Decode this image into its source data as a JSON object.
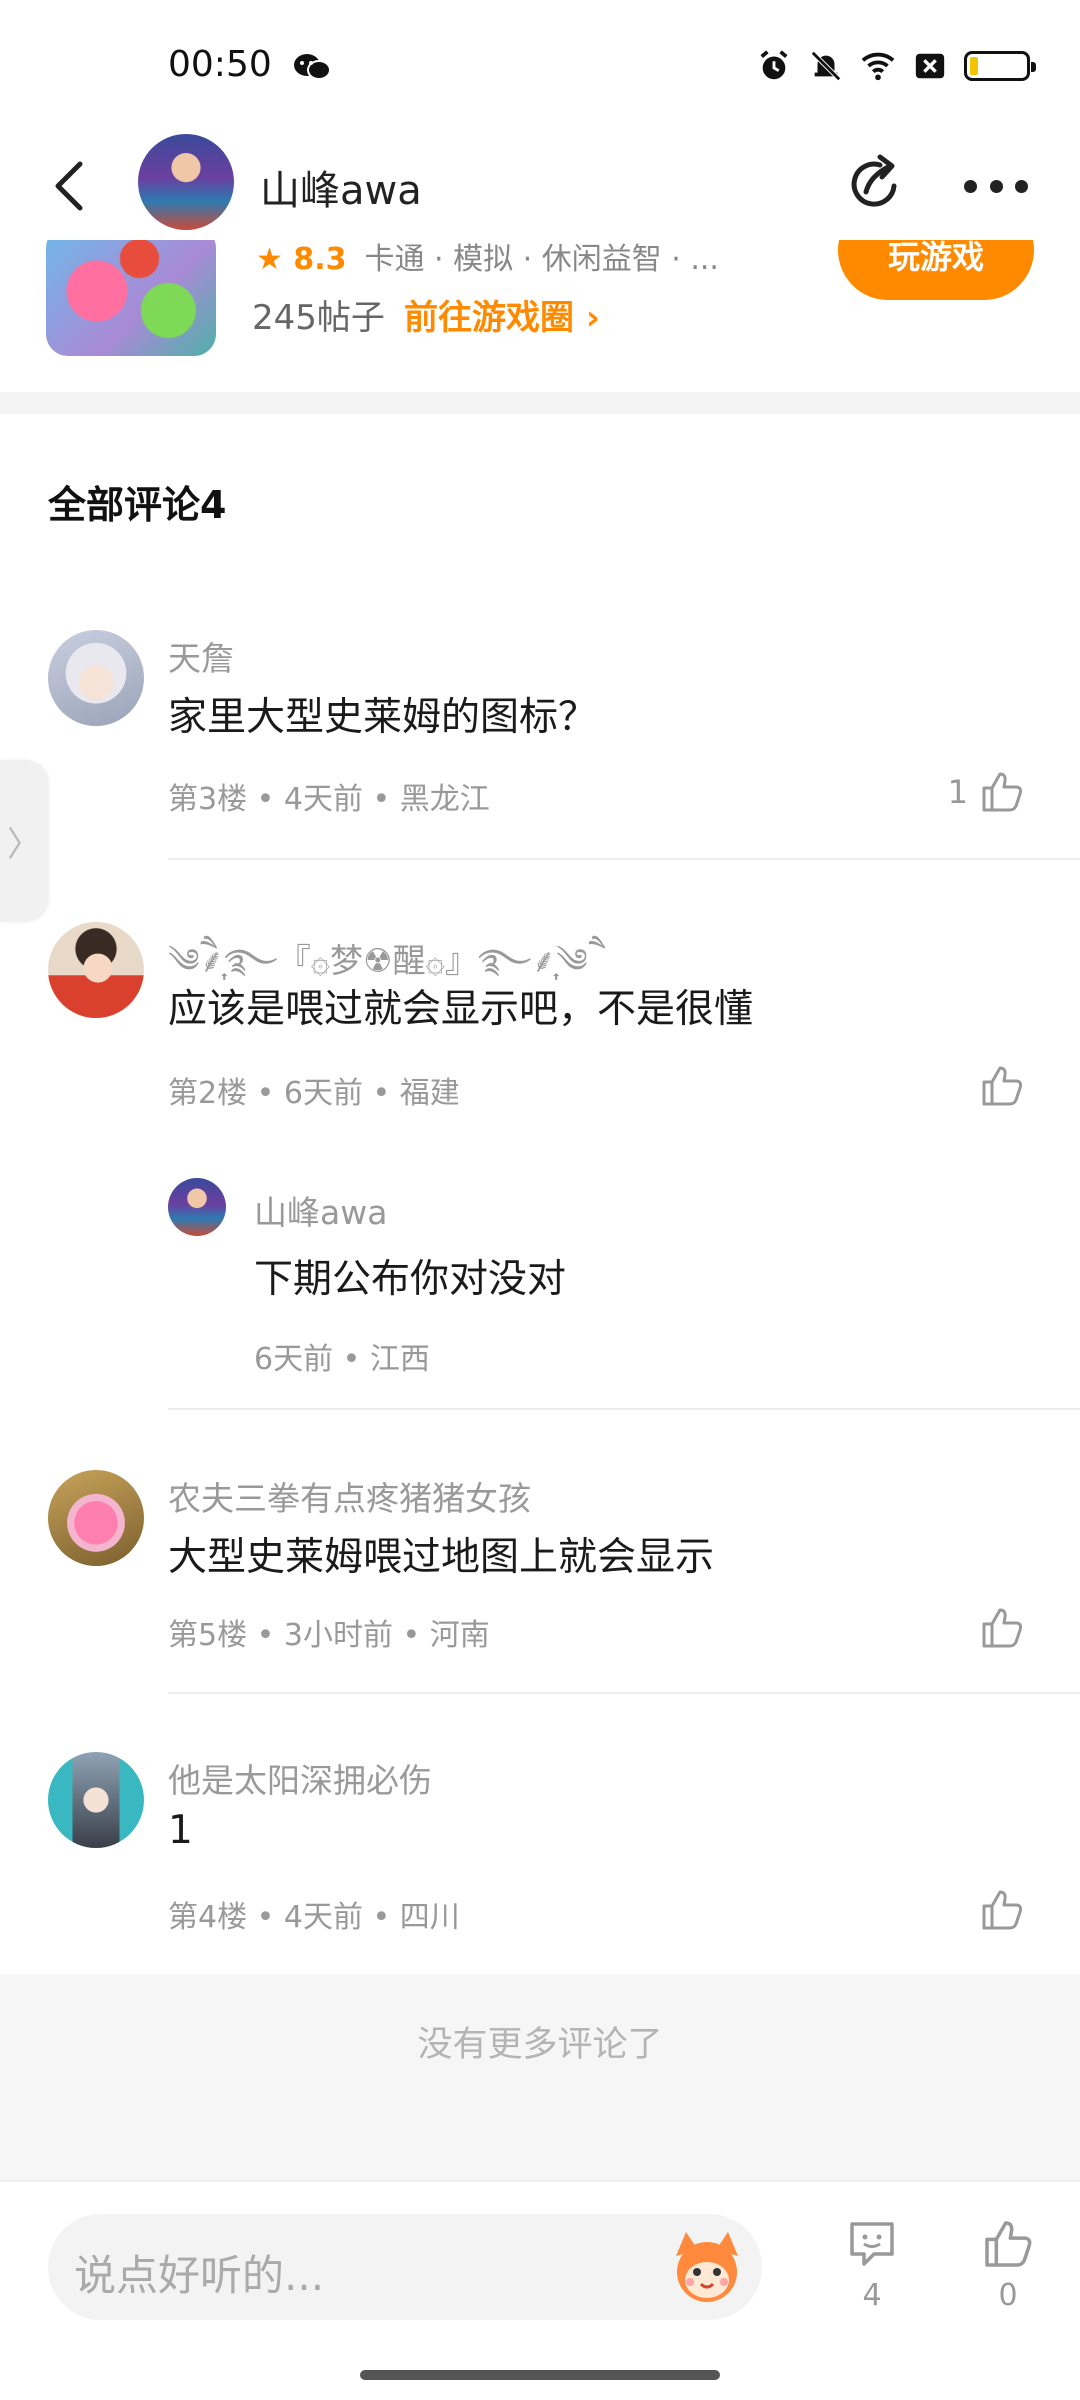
{
  "status": {
    "time": "00:50"
  },
  "header": {
    "name": "山峰awa"
  },
  "game": {
    "rating": "8.3",
    "tags": "卡通 · 模拟 · 休闲益智 · ...",
    "posts": "245帖子",
    "link": "前往游戏圈 ›",
    "play": "玩游戏"
  },
  "comments_title": "全部评论4",
  "comments": [
    {
      "name": "天詹",
      "text": "家里大型史莱姆的图标？",
      "meta": "第3楼 • 4天前 • 黑龙江",
      "likes": "1"
    },
    {
      "name": "༄ཻ⸙͎࿐『۞梦☢醒۞』࿐⸙͎༄ཻ",
      "text": "应该是喂过就会显示吧，不是很懂",
      "meta": "第2楼 • 6天前 • 福建",
      "likes": "",
      "reply": {
        "name": "山峰awa",
        "text": "下期公布你对没对",
        "meta": "6天前 • 江西"
      }
    },
    {
      "name": "农夫三拳有点疼猪猪女孩",
      "text": "大型史莱姆喂过地图上就会显示",
      "meta": "第5楼 • 3小时前 • 河南",
      "likes": ""
    },
    {
      "name": "他是太阳深拥必伤",
      "text": "1",
      "meta": "第4楼 • 4天前 • 四川",
      "likes": ""
    }
  ],
  "no_more": "没有更多评论了",
  "bottom": {
    "placeholder": "说点好听的...",
    "comment_count": "4",
    "like_count": "0"
  },
  "side_tab": "〉"
}
